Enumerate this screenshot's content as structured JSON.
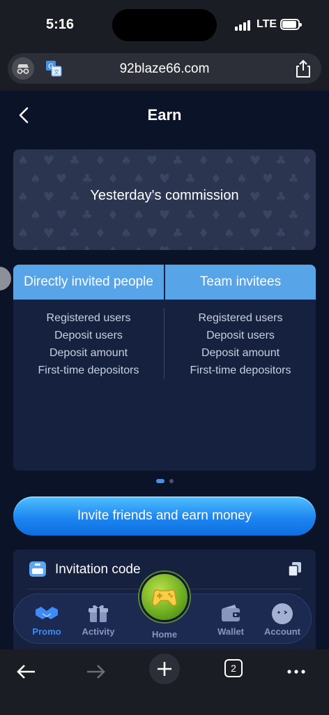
{
  "status_bar": {
    "time": "5:16",
    "network": "LTE"
  },
  "browser": {
    "url": "92blaze66.com",
    "tab_count": "2"
  },
  "header": {
    "title": "Earn"
  },
  "commission": {
    "label": "Yesterday's commission"
  },
  "stats": {
    "left_tab": "Directly invited people",
    "right_tab": "Team invitees",
    "left_rows": [
      "Registered users",
      "Deposit users",
      "Deposit amount",
      "First-time depositors"
    ],
    "right_rows": [
      "Registered users",
      "Deposit users",
      "Deposit amount",
      "First-time depositors"
    ]
  },
  "invite_button": {
    "label": "Invite friends and earn money"
  },
  "invitation_code": {
    "label": "Invitation code"
  },
  "tabbar": {
    "items": [
      {
        "label": "Promo",
        "icon": "handshake-icon",
        "active": true
      },
      {
        "label": "Activity",
        "icon": "gift-icon",
        "active": false
      },
      {
        "label": "Home",
        "icon": "gamepad-icon",
        "active": false
      },
      {
        "label": "Wallet",
        "icon": "wallet-icon",
        "active": false
      },
      {
        "label": "Account",
        "icon": "avatar-icon",
        "active": false
      }
    ]
  },
  "colors": {
    "background": "#0b1328",
    "tab_blue": "#58a4e9",
    "button_blue": "#1e86f0",
    "active_tab": "#3d8cf5",
    "home_green": "#6aaa1e"
  }
}
